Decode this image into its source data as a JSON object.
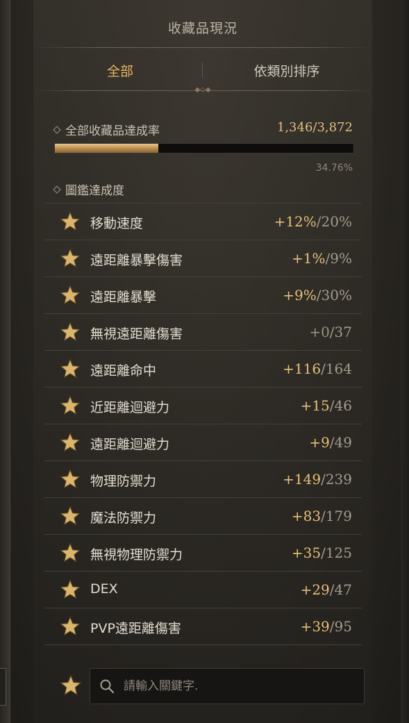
{
  "header": {
    "title": "收藏品現況"
  },
  "tabs": {
    "all": "全部",
    "by_category": "依類別排序"
  },
  "overall": {
    "label": "全部收藏品達成率",
    "count": "1,346/3,872",
    "percent_text": "34.76%",
    "progress": 0.3476
  },
  "codex": {
    "label": "圖鑑達成度",
    "items": [
      {
        "name": "移動速度",
        "current": "+12%",
        "max": "20%"
      },
      {
        "name": "遠距離暴擊傷害",
        "current": "+1%",
        "max": "9%"
      },
      {
        "name": "遠距離暴擊",
        "current": "+9%",
        "max": "30%"
      },
      {
        "name": "無視遠距離傷害",
        "current": "+0",
        "max": "37"
      },
      {
        "name": "遠距離命中",
        "current": "+116",
        "max": "164"
      },
      {
        "name": "近距離迴避力",
        "current": "+15",
        "max": "46"
      },
      {
        "name": "遠距離迴避力",
        "current": "+9",
        "max": "49"
      },
      {
        "name": "物理防禦力",
        "current": "+149",
        "max": "239"
      },
      {
        "name": "魔法防禦力",
        "current": "+83",
        "max": "179"
      },
      {
        "name": "無視物理防禦力",
        "current": "+35",
        "max": "125"
      },
      {
        "name": "DEX",
        "current": "+29",
        "max": "47"
      },
      {
        "name": "PVP遠距離傷害",
        "current": "+39",
        "max": "95"
      }
    ]
  },
  "search": {
    "placeholder": "請輸入關鍵字."
  },
  "colors": {
    "accent": "#e8b561",
    "value": "#e6c07a",
    "star": "#d9b56e"
  }
}
